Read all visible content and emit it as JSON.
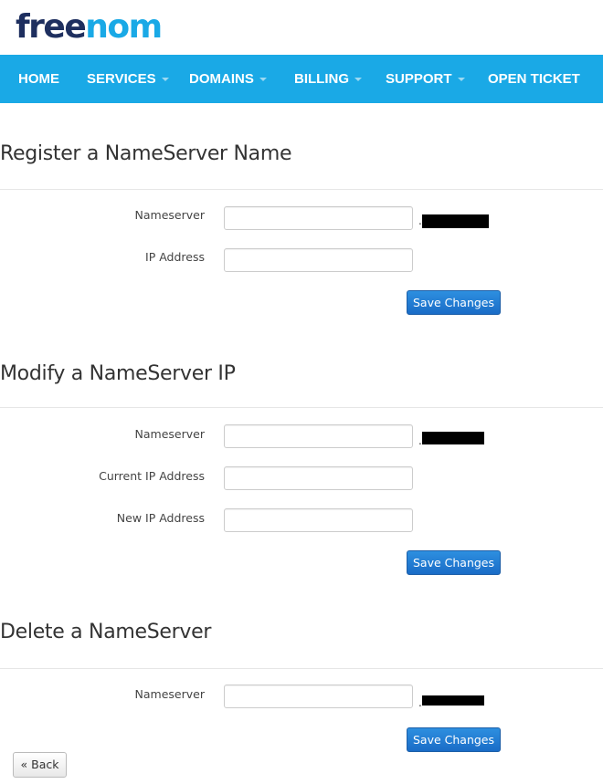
{
  "logo": {
    "part1": "free",
    "part2": "nom"
  },
  "nav": {
    "items": [
      {
        "label": "HOME",
        "dropdown": false
      },
      {
        "label": "SERVICES",
        "dropdown": true
      },
      {
        "label": "DOMAINS",
        "dropdown": true
      },
      {
        "label": "BILLING",
        "dropdown": true
      },
      {
        "label": "SUPPORT",
        "dropdown": true
      },
      {
        "label": "OPEN TICKET",
        "dropdown": false
      }
    ]
  },
  "register": {
    "title": "Register a NameServer Name",
    "nameserver_label": "Nameserver",
    "nameserver_value": "",
    "suffix": ".",
    "ip_label": "IP Address",
    "ip_value": "",
    "save_label": "Save Changes"
  },
  "modify": {
    "title": "Modify a NameServer IP",
    "nameserver_label": "Nameserver",
    "nameserver_value": "",
    "suffix": ".",
    "current_ip_label": "Current IP Address",
    "current_ip_value": "",
    "new_ip_label": "New IP Address",
    "new_ip_value": "",
    "save_label": "Save Changes"
  },
  "delete": {
    "title": "Delete a NameServer",
    "nameserver_label": "Nameserver",
    "nameserver_value": "",
    "suffix": ".",
    "save_label": "Save Changes"
  },
  "back_label": "« Back",
  "colors": {
    "nav_bg": "#1aa9e6",
    "logo_dark": "#1e2f5f",
    "logo_light": "#1aa9e6",
    "button_blue": "#1a6cc7"
  }
}
